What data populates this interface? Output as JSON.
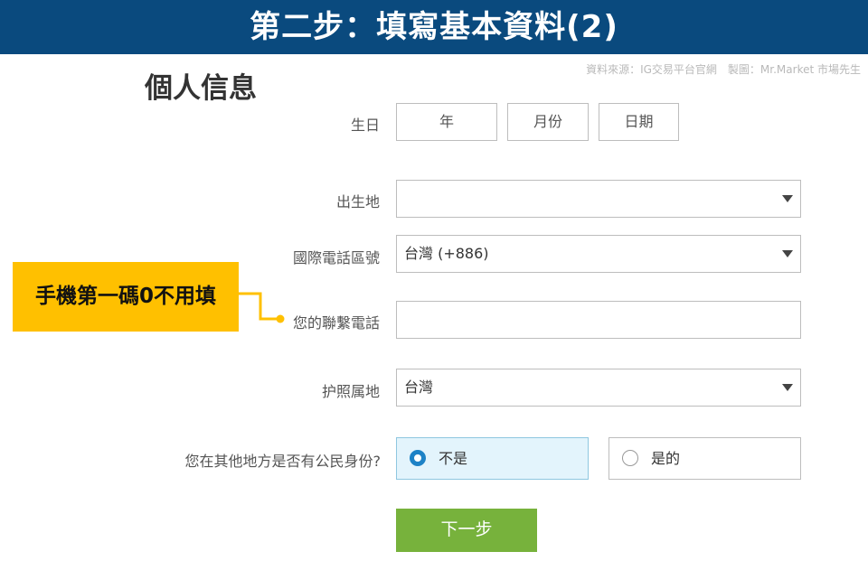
{
  "banner": {
    "title": "第二步：填寫基本資料(2)"
  },
  "source_note": "資料來源：IG交易平台官網　製圖：Mr.Market 市場先生",
  "section_title": "個人信息",
  "birthday": {
    "label": "生日",
    "year": "年",
    "month": "月份",
    "day": "日期"
  },
  "birthplace": {
    "label": "出生地",
    "value": ""
  },
  "country_code": {
    "label": "國際電話區號",
    "value": "台灣 (+886)"
  },
  "phone": {
    "label": "您的聯繫電話",
    "value": ""
  },
  "passport": {
    "label": "护照属地",
    "value": "台灣"
  },
  "citizenship": {
    "label": "您在其他地方是否有公民身份?",
    "options": [
      {
        "label": "不是",
        "selected": true
      },
      {
        "label": "是的",
        "selected": false
      }
    ]
  },
  "next_button": "下一步",
  "callout": {
    "text": "手機第一碼0不用填",
    "color": "#ffc000"
  },
  "colors": {
    "banner": "#0a4a7e",
    "button": "#77b23c",
    "radio_selected": "#1d82c6"
  }
}
